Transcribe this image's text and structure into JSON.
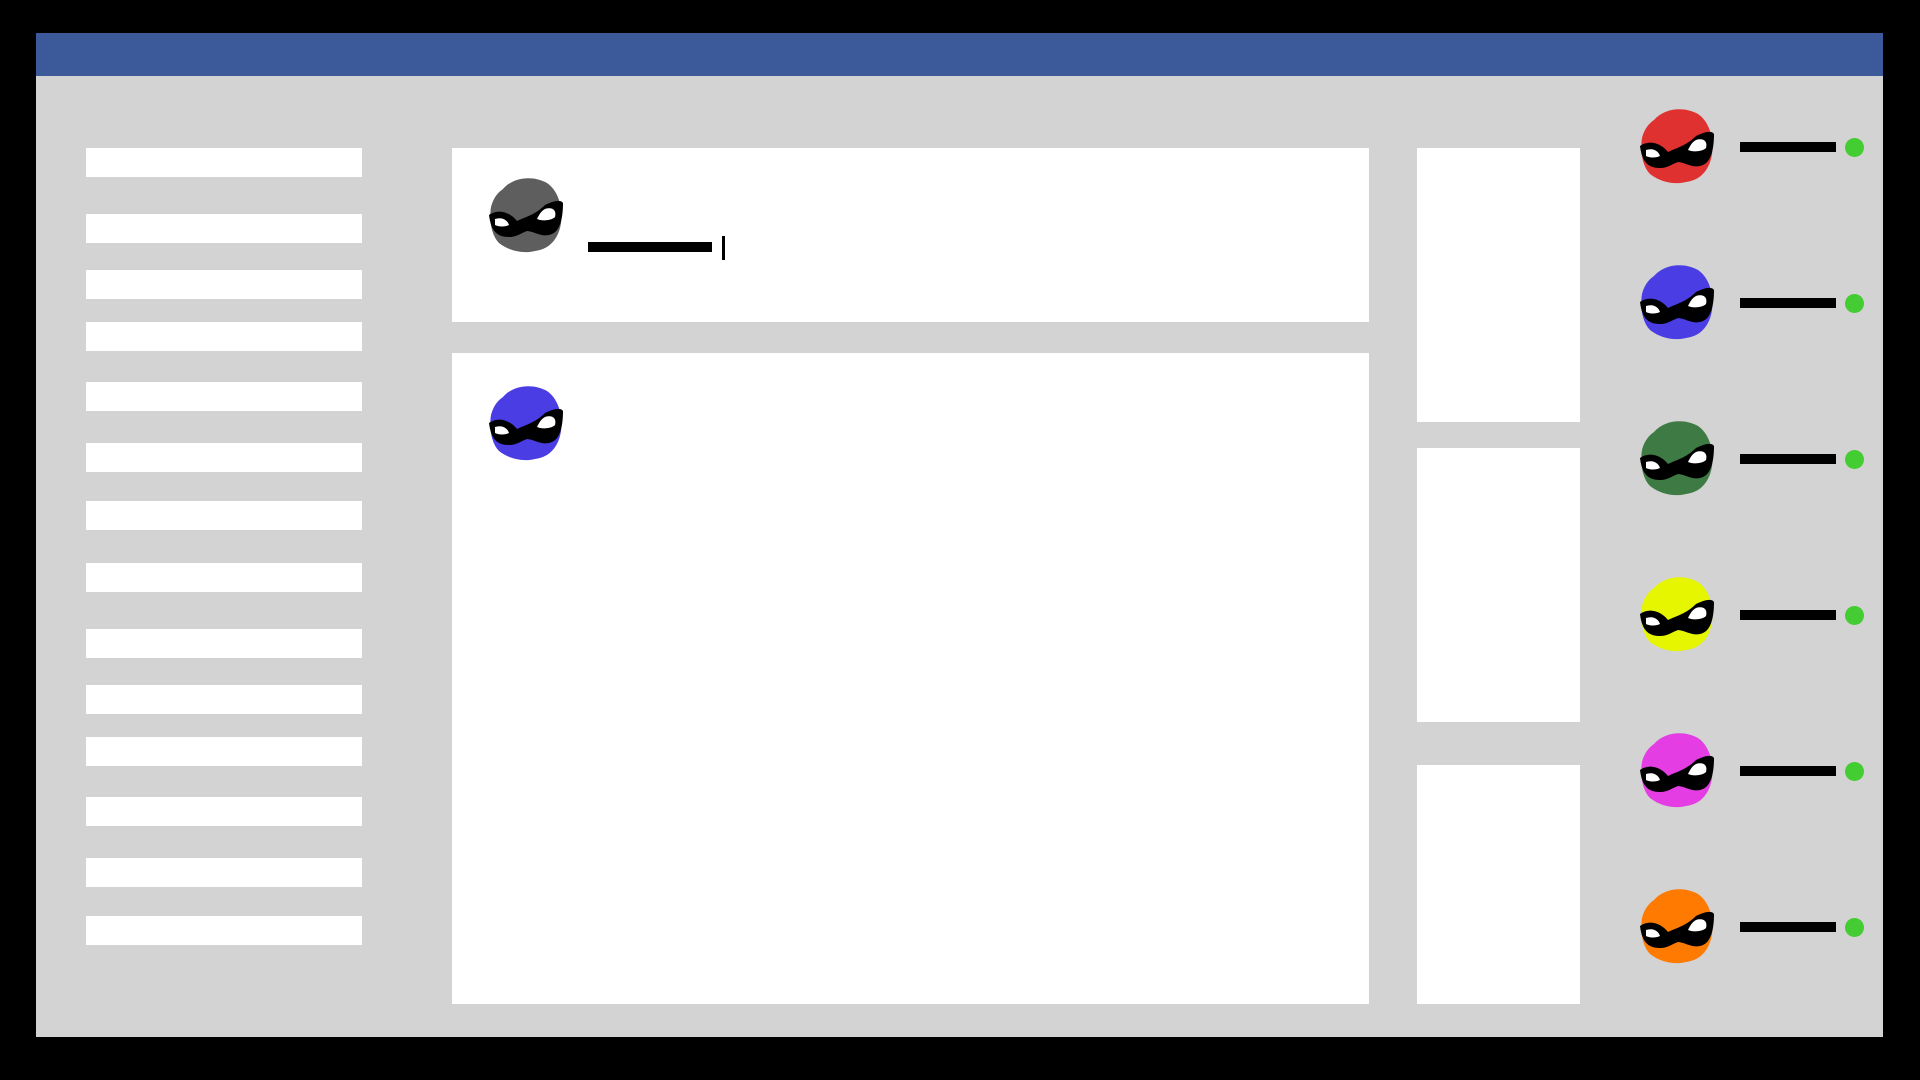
{
  "app": {
    "brand_color": "#3c5a99",
    "background_color": "#d3d3d3"
  },
  "left_nav": {
    "item_count": 14
  },
  "composer": {
    "avatar_color": "#5e5e5e",
    "avatar_icon": "masked-face-icon",
    "text_placeholder_line": true
  },
  "post": {
    "avatar_color": "#4a3de3",
    "avatar_icon": "masked-face-icon"
  },
  "side_cards": {
    "count": 3
  },
  "contacts": [
    {
      "avatar_color": "#e03131",
      "status": "online",
      "status_color": "#44cc33"
    },
    {
      "avatar_color": "#4a3de3",
      "status": "online",
      "status_color": "#44cc33"
    },
    {
      "avatar_color": "#3d7a44",
      "status": "online",
      "status_color": "#44cc33"
    },
    {
      "avatar_color": "#e6f500",
      "status": "online",
      "status_color": "#44cc33"
    },
    {
      "avatar_color": "#e33de3",
      "status": "online",
      "status_color": "#44cc33"
    },
    {
      "avatar_color": "#ff7a00",
      "status": "online",
      "status_color": "#44cc33"
    }
  ]
}
